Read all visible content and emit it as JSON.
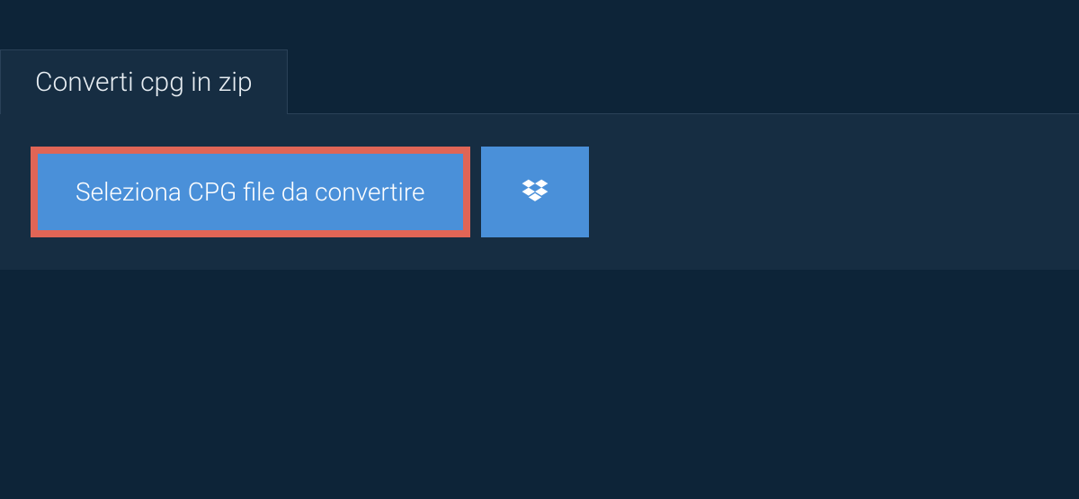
{
  "tab": {
    "label": "Converti cpg in zip"
  },
  "buttons": {
    "select_file_label": "Seleziona CPG file da convertire"
  }
}
